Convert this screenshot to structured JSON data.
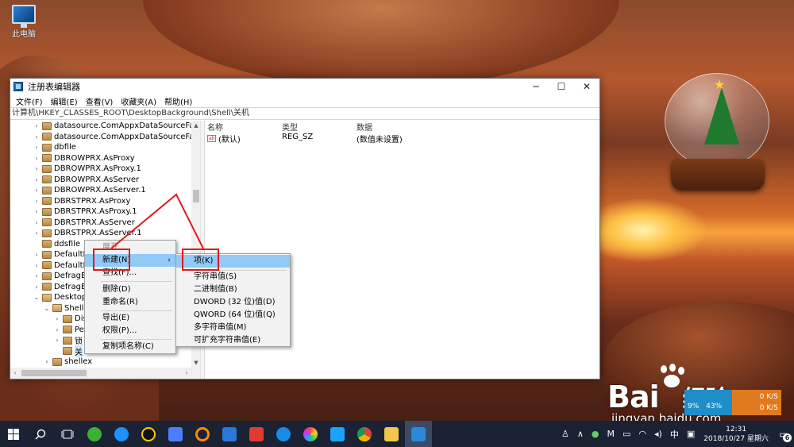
{
  "desktop": {
    "icon_label": "此电脑"
  },
  "window": {
    "title": "注册表编辑器",
    "minimize": "─",
    "maximize": "☐",
    "close": "✕",
    "menus": [
      "文件(F)",
      "编辑(E)",
      "查看(V)",
      "收藏夹(A)",
      "帮助(H)"
    ],
    "address": "计算机\\HKEY_CLASSES_ROOT\\DesktopBackground\\Shell\\关机"
  },
  "tree": {
    "items": [
      {
        "label": "datasource.ComAppxDataSourceFacto",
        "expander": "›"
      },
      {
        "label": "datasource.ComAppxDataSourceFacto",
        "expander": "›"
      },
      {
        "label": "dbfile",
        "expander": "›"
      },
      {
        "label": "DBROWPRX.AsProxy",
        "expander": "›"
      },
      {
        "label": "DBROWPRX.AsProxy.1",
        "expander": "›"
      },
      {
        "label": "DBROWPRX.AsServer",
        "expander": "›"
      },
      {
        "label": "DBROWPRX.AsServer.1",
        "expander": "›"
      },
      {
        "label": "DBRSTPRX.AsProxy",
        "expander": "›"
      },
      {
        "label": "DBRSTPRX.AsProxy.1",
        "expander": "›"
      },
      {
        "label": "DBRSTPRX.AsServer",
        "expander": "›"
      },
      {
        "label": "DBRSTPRX.AsServer.1",
        "expander": "›"
      },
      {
        "label": "ddsfile",
        "expander": ""
      },
      {
        "label": "DefaultL",
        "expander": "›"
      },
      {
        "label": "DefaultL",
        "expander": "›"
      },
      {
        "label": "DefragEi",
        "expander": "›"
      },
      {
        "label": "DefragEi",
        "expander": "›"
      },
      {
        "label": "Desktop",
        "expander": "⌄"
      },
      {
        "label": "Shell",
        "expander": "⌄"
      },
      {
        "label": "Dis",
        "expander": "›"
      },
      {
        "label": "Pe",
        "expander": "›"
      },
      {
        "label": "锁",
        "expander": "›"
      },
      {
        "label": "关",
        "expander": ""
      },
      {
        "label": "shellex",
        "expander": "›"
      }
    ],
    "scroll_up": "▲",
    "scroll_down": "▼",
    "scroll_left": "‹",
    "scroll_right": "›"
  },
  "list": {
    "columns": [
      "名称",
      "类型",
      "数据"
    ],
    "rows": [
      {
        "name": "(默认)",
        "type": "REG_SZ",
        "data": "(数值未设置)",
        "icon": "ab"
      }
    ]
  },
  "context_menu": {
    "items": [
      {
        "label": "展开"
      },
      {
        "label": "新建(N)",
        "arrow": "›"
      },
      {
        "label": "查找(F)..."
      },
      {
        "label": "删除(D)"
      },
      {
        "label": "重命名(R)"
      },
      {
        "label": "导出(E)"
      },
      {
        "label": "权限(P)..."
      },
      {
        "label": "复制项名称(C)"
      }
    ]
  },
  "submenu": {
    "items": [
      {
        "label": "项(K)"
      },
      {
        "label": "字符串值(S)"
      },
      {
        "label": "二进制值(B)"
      },
      {
        "label": "DWORD (32 位)值(D)"
      },
      {
        "label": "QWORD (64 位)值(Q)"
      },
      {
        "label": "多字符串值(M)"
      },
      {
        "label": "可扩充字符串值(E)"
      }
    ]
  },
  "watermark": {
    "brand": "Bai",
    "brand2": "经验",
    "site": "jingyan.baidu.com"
  },
  "speed_widget": {
    "cpu": "9%",
    "mem": "43%",
    "up": "0 K/S",
    "down": "0 K/S"
  },
  "taskbar": {
    "tray_ime": "中",
    "time": "12:31",
    "date": "2018/10/27 星期六",
    "notification_count": "6",
    "tray_expand": "∧",
    "tray_app": "M"
  },
  "colors": {
    "highlight": "#91c9f7",
    "annotation": "#e01b1b",
    "taskbar": "#1b2233"
  }
}
